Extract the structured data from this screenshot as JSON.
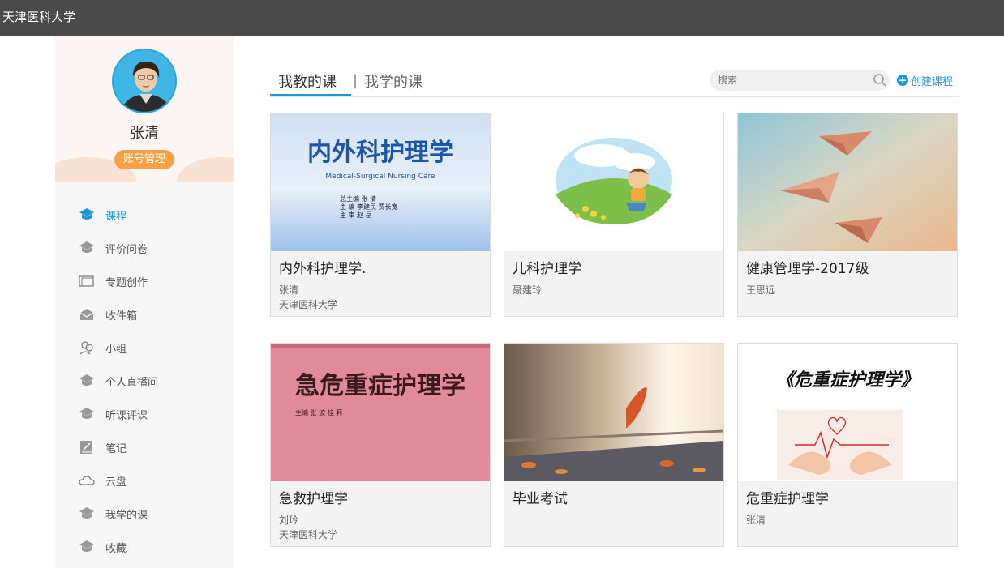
{
  "header": {
    "title": "天津医科大学"
  },
  "profile": {
    "name": "张清",
    "account_button": "账号管理"
  },
  "nav": [
    {
      "label": "课程",
      "icon": "course-icon",
      "active": true
    },
    {
      "label": "评价问卷",
      "icon": "survey-icon"
    },
    {
      "label": "专题创作",
      "icon": "topic-icon"
    },
    {
      "label": "收件箱",
      "icon": "inbox-icon"
    },
    {
      "label": "小组",
      "icon": "group-icon"
    },
    {
      "label": "个人直播间",
      "icon": "live-icon"
    },
    {
      "label": "听课评课",
      "icon": "evaluation-icon"
    },
    {
      "label": "笔记",
      "icon": "note-icon"
    },
    {
      "label": "云盘",
      "icon": "cloud-icon"
    },
    {
      "label": "我学的课",
      "icon": "learning-icon"
    },
    {
      "label": "收藏",
      "icon": "favorite-icon"
    }
  ],
  "tabs": {
    "teaching": "我教的课",
    "separator": "|",
    "learning": "我学的课"
  },
  "search": {
    "placeholder": "搜索"
  },
  "create_button": "创建课程",
  "courses": [
    {
      "title": "内外科护理学.",
      "teacher": "张清",
      "school": "天津医科大学",
      "cover": {
        "title": "内外科护理学",
        "subtitle": "Medical-Surgical Nursing Care",
        "lines": [
          "总主编  张   清",
          "主   编  李建民   贾长宽",
          "主   审  赵   岳"
        ]
      }
    },
    {
      "title": "儿科护理学",
      "teacher": "聂建玲",
      "school": ""
    },
    {
      "title": "健康管理学-2017级",
      "teacher": "王思远",
      "school": ""
    },
    {
      "title": "急救护理学",
      "teacher": "刘玲",
      "school": "天津医科大学",
      "cover": {
        "title": "急危重症护理学",
        "subtitle": "主编  张 波  桂 莉"
      }
    },
    {
      "title": "毕业考试",
      "teacher": "",
      "school": ""
    },
    {
      "title": "危重症护理学",
      "teacher": "张清",
      "school": "",
      "cover": {
        "title": "《危重症护理学》"
      }
    }
  ],
  "colors": {
    "accent": "#1a97e0",
    "topbar": "#4a4a4a",
    "orange": "#f7a045"
  }
}
